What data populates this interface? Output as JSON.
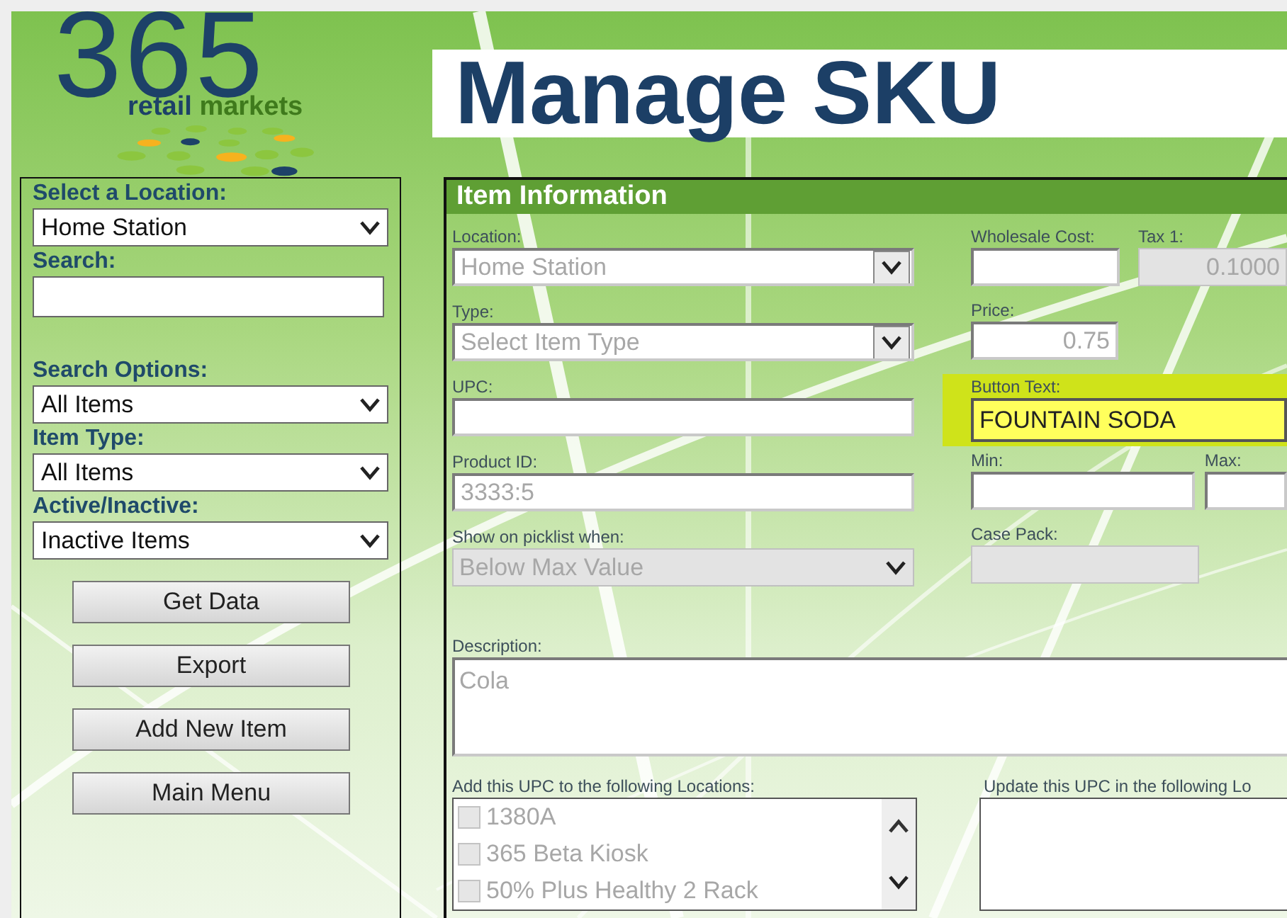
{
  "logo": {
    "number": "365",
    "brand": "retail",
    "brand_accent": "markets"
  },
  "page_title": "Manage SKU",
  "sidebar": {
    "fields": [
      {
        "label": "Select a Location:",
        "kind": "select",
        "value": "Home Station"
      },
      {
        "label": "Search:",
        "kind": "text"
      },
      {
        "label": "Search Options:",
        "kind": "select",
        "value": "All Items"
      },
      {
        "label": "Item Type:",
        "kind": "select",
        "value": "All Items"
      },
      {
        "label": "Active/Inactive:",
        "kind": "select",
        "value": "Inactive Items"
      }
    ],
    "buttons": [
      "Get Data",
      "Export",
      "Add New Item",
      "Main Menu"
    ]
  },
  "item_information": {
    "title": "Item Information",
    "left_fields": [
      {
        "label": "Location:",
        "kind": "combo",
        "value": "Home Station",
        "disabled": true
      },
      {
        "label": "Type:",
        "kind": "combo",
        "value": "Select Item Type",
        "disabled": true
      },
      {
        "label": "UPC:",
        "kind": "text"
      },
      {
        "label": "Product ID:",
        "kind": "text",
        "value": "3333:5",
        "disabled": true
      },
      {
        "label": "Show on picklist when:",
        "kind": "select",
        "value": "Below Max Value",
        "disabled": true
      }
    ],
    "right_rows": [
      [
        {
          "label": "Wholesale Cost:",
          "kind": "text"
        },
        {
          "label": "Tax 1:",
          "kind": "locked",
          "value": "0.1000",
          "disabled": true
        }
      ],
      [
        {
          "label": "Price:",
          "kind": "number",
          "value": "0.75",
          "disabled": true
        }
      ],
      [
        {
          "label": "Button Text:",
          "kind": "text",
          "value": "FOUNTAIN SODA",
          "disabled": false,
          "highlighted": true
        }
      ],
      [
        {
          "label": "Min:",
          "kind": "text"
        },
        {
          "label": "Max:",
          "kind": "text"
        }
      ],
      [
        {
          "label": "Case Pack:",
          "kind": "locked"
        }
      ]
    ],
    "description": {
      "label": "Description:",
      "value": "Cola",
      "disabled": true
    },
    "add_locations": {
      "label": "Add this UPC to the following Locations:",
      "items": [
        {
          "label": "1380A",
          "checked": false,
          "disabled": true
        },
        {
          "label": "365 Beta Kiosk",
          "checked": false,
          "disabled": true
        },
        {
          "label": "50% Plus Healthy 2 Rack",
          "checked": false,
          "disabled": true
        }
      ]
    },
    "update_locations": {
      "label": "Update this UPC in the following Lo"
    }
  }
}
